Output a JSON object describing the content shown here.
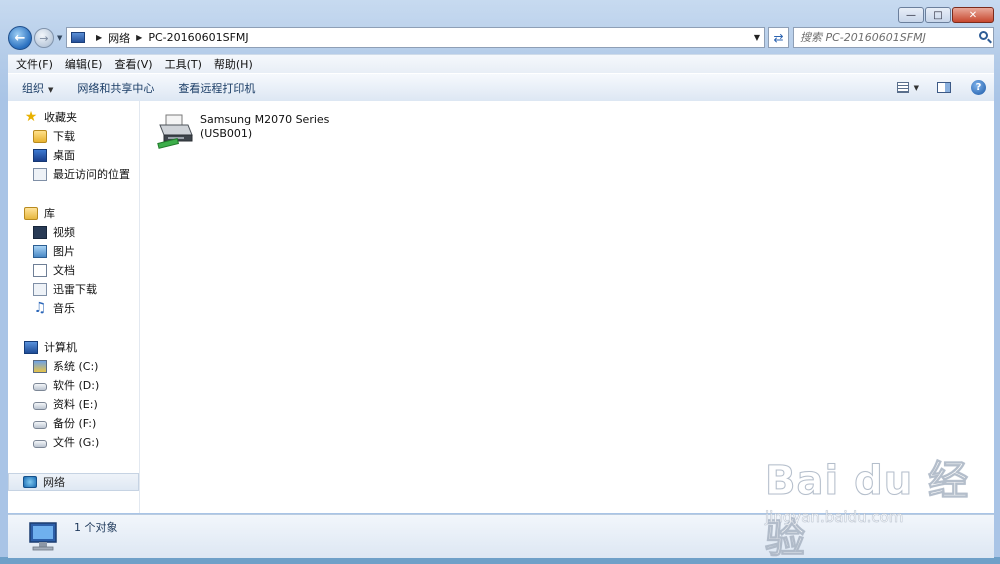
{
  "window": {
    "controls": [
      "minimize",
      "maximize",
      "close"
    ]
  },
  "address_bar": {
    "crumbs": [
      "网络",
      "PC-20160601SFMJ"
    ]
  },
  "search": {
    "placeholder": "搜索 PC-20160601SFMJ"
  },
  "menu": [
    "文件(F)",
    "编辑(E)",
    "查看(V)",
    "工具(T)",
    "帮助(H)"
  ],
  "toolbar": {
    "organize": "组织",
    "network_center": "网络和共享中心",
    "remote_printers": "查看远程打印机"
  },
  "sidebar": {
    "favorites": {
      "label": "收藏夹",
      "items": [
        "下载",
        "桌面",
        "最近访问的位置"
      ]
    },
    "libraries": {
      "label": "库",
      "items": [
        "视频",
        "图片",
        "文档",
        "迅雷下载",
        "音乐"
      ]
    },
    "computer": {
      "label": "计算机",
      "items": [
        "系统 (C:)",
        "软件 (D:)",
        "资料 (E:)",
        "备份 (F:)",
        "文件 (G:)"
      ]
    },
    "network": {
      "label": "网络"
    }
  },
  "content": {
    "device_name": "Samsung M2070 Series",
    "device_port": "(USB001)"
  },
  "status": {
    "count": "1 个对象"
  },
  "watermark": {
    "logo": "Bai du 经验",
    "url": "jingyan.baidu.com"
  },
  "colors": {
    "frame": "#b3cbe8",
    "link": "#1b3d66",
    "close": "#c7472e"
  }
}
